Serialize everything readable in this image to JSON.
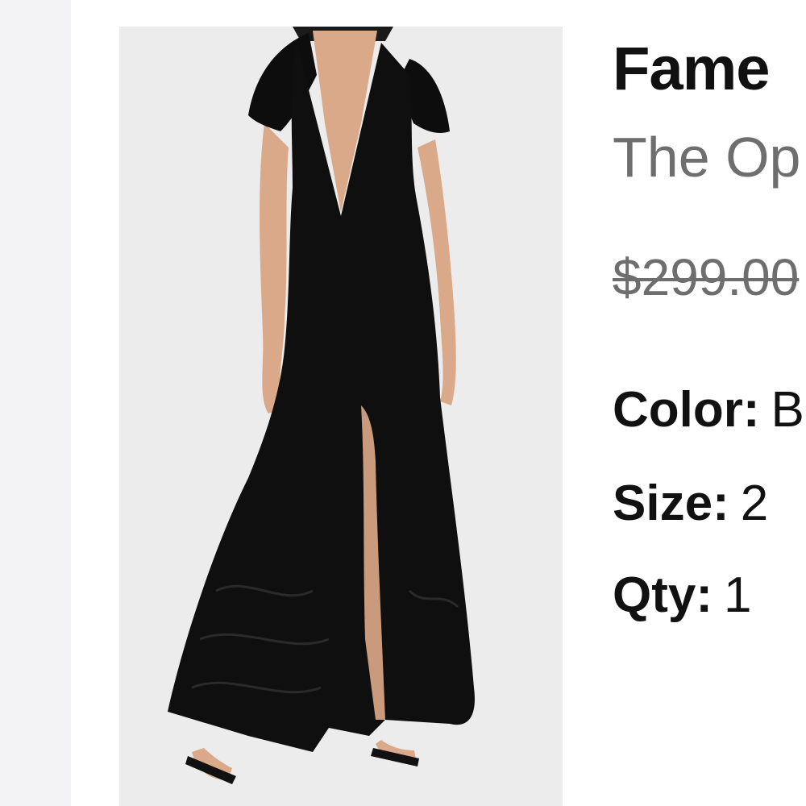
{
  "product": {
    "brand": "Fame",
    "name": "The Op",
    "original_price": "$299.00",
    "image_alt": "Black lace V-neck gown with flutter sleeves and front slit"
  },
  "attributes": {
    "color": {
      "label": "Color:",
      "value": "B"
    },
    "size": {
      "label": "Size:",
      "value": "2"
    },
    "qty": {
      "label": "Qty:",
      "value": "1"
    }
  },
  "colors": {
    "background": "#ffffff",
    "rail": "#f3f3f5",
    "image_bg": "#ededed",
    "text_primary": "#111111",
    "text_secondary": "#6e6e6e"
  }
}
